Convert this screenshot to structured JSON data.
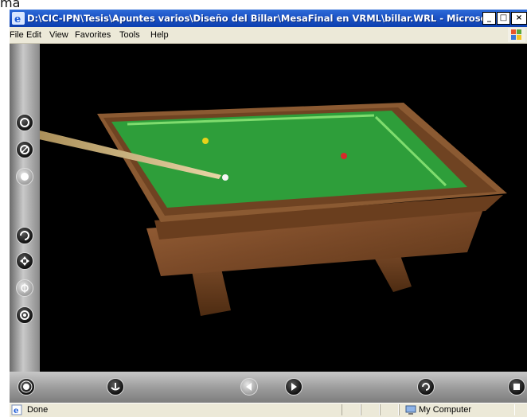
{
  "above_text": "ma",
  "window": {
    "title": "D:\\CIC-IPN\\Tesis\\Apuntes varios\\Diseño del Billar\\MesaFinal en VRML\\billar.WRL - Microsoft ...",
    "buttons": {
      "minimize": "_",
      "maximize": "□",
      "close": "×"
    }
  },
  "menu": [
    "File",
    "Edit",
    "View",
    "Favorites",
    "Tools",
    "Help"
  ],
  "status": {
    "left": "Done",
    "zone": "My Computer"
  },
  "icons": {
    "app": "ie-icon",
    "brand": "windows-logo",
    "status_left": "ie-page-icon",
    "status_zone": "my-computer-icon"
  },
  "colors": {
    "titlebar": "#0c3fb0",
    "felt": "#2e9e3a",
    "wood": "#7a4a2a",
    "background": "#000000"
  }
}
